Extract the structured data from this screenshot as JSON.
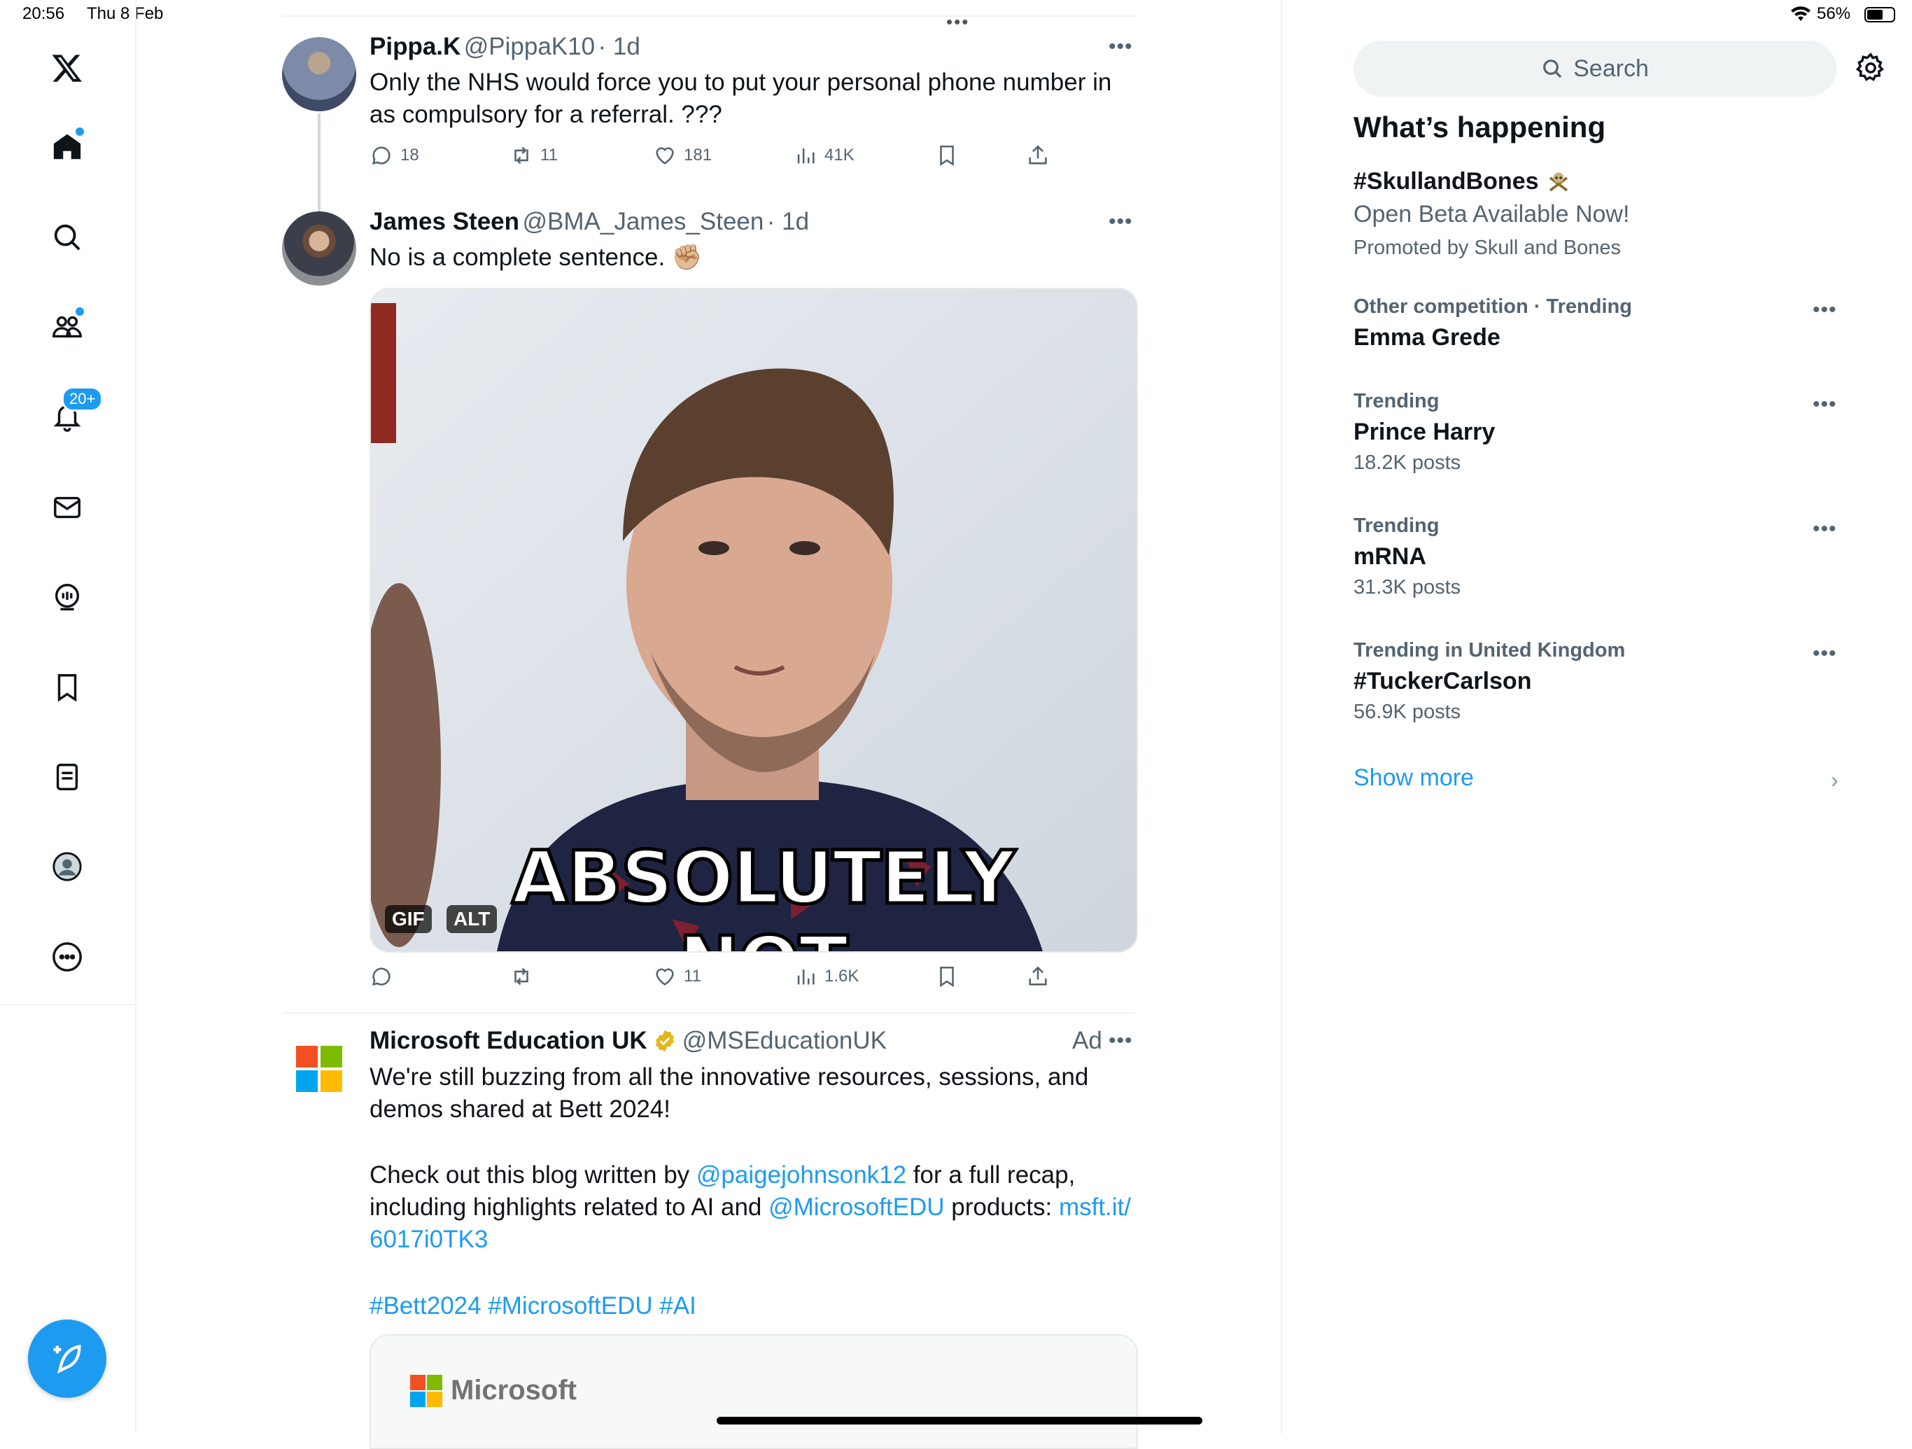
{
  "status_bar": {
    "time": "20:56",
    "date": "Thu 8 Feb",
    "battery": "56%"
  },
  "nav": {
    "notifications_badge": "20+"
  },
  "tweets": [
    {
      "name": "Pippa.K",
      "handle": "@PippaK10",
      "time": "· 1d",
      "text": "Only the NHS would force you to put your personal phone number in as compulsory for a referral. ???",
      "replies": "18",
      "retweets": "11",
      "likes": "181",
      "views": "41K"
    },
    {
      "name": "James Steen",
      "handle": "@BMA_James_Steen",
      "time": "· 1d",
      "text": "No is a complete sentence. ✊🏼",
      "media_caption": "ABSOLUTELY NOT",
      "gif_label": "GIF",
      "alt_label": "ALT",
      "replies": "",
      "retweets": "",
      "likes": "11",
      "views": "1.6K"
    }
  ],
  "ad": {
    "name": "Microsoft Education UK",
    "handle": "@MSEducationUK",
    "ad_label": "Ad",
    "line1": "We're still buzzing from all the innovative resources, sessions, and demos shared at Bett 2024!",
    "line2_a": "Check out this blog written by ",
    "line2_link": "@paigejohnsonk12",
    "line2_b": " for a full recap, including highlights related to AI and ",
    "line2_link2": "@MicrosoftEDU",
    "line2_c": " products: ",
    "line2_url": "msft.it/6017i0TK3",
    "hashtags": "#Bett2024 #MicrosoftEDU #AI",
    "card_logo_text": "Microsoft"
  },
  "sidebar": {
    "search_placeholder": "Search",
    "heading": "What’s happening",
    "promoted": {
      "tag": "#SkullandBones",
      "subtitle": "Open Beta Available Now!",
      "promoted_by": "Promoted by Skull and Bones"
    },
    "trends": [
      {
        "meta": "Other competition · Trending",
        "name": "Emma Grede",
        "count": ""
      },
      {
        "meta": "Trending",
        "name": "Prince Harry",
        "count": "18.2K posts"
      },
      {
        "meta": "Trending",
        "name": "mRNA",
        "count": "31.3K posts"
      },
      {
        "meta": "Trending in United Kingdom",
        "name": "#TuckerCarlson",
        "count": "56.9K posts"
      }
    ],
    "show_more": "Show more"
  },
  "colors": {
    "accent": "#1d9bf0",
    "text": "#0f1419",
    "muted": "#536471"
  }
}
